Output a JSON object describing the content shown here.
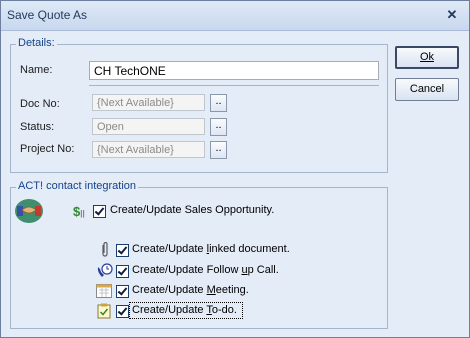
{
  "window": {
    "title": "Save Quote As"
  },
  "details": {
    "legend": "Details:",
    "name_label": "Name:",
    "name_value": "CH TechONE",
    "docno_label": "Doc No:",
    "docno_value": "{Next Available}",
    "status_label": "Status:",
    "status_value": "Open",
    "project_label": "Project No:",
    "project_value": "{Next Available}",
    "browse_label": ".."
  },
  "buttons": {
    "ok": "Ok",
    "cancel": "Cancel"
  },
  "act": {
    "legend": "ACT! contact integration",
    "opportunity": "Create/Update Sales Opportunity.",
    "document": "Create/Update linked document.",
    "followup": "Create/Update Follow up Call.",
    "meeting": "Create/Update Meeting.",
    "todo": "Create/Update To-do."
  }
}
